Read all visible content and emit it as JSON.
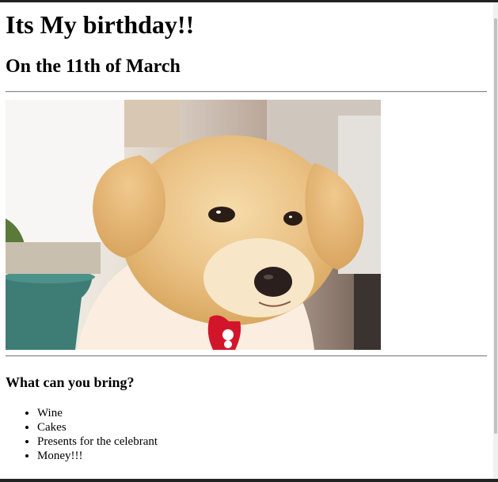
{
  "page": {
    "title": "Its My birthday!!",
    "subtitle": "On the 11th of March"
  },
  "photo": {
    "subject": "golden-retriever-puppy"
  },
  "bring_section": {
    "heading": "What can you bring?",
    "items": [
      "Wine",
      "Cakes",
      "Presents for the celebrant",
      "Money!!!"
    ]
  },
  "colors": {
    "background": "#ffffff",
    "text": "#000000",
    "rule": "#888888"
  }
}
